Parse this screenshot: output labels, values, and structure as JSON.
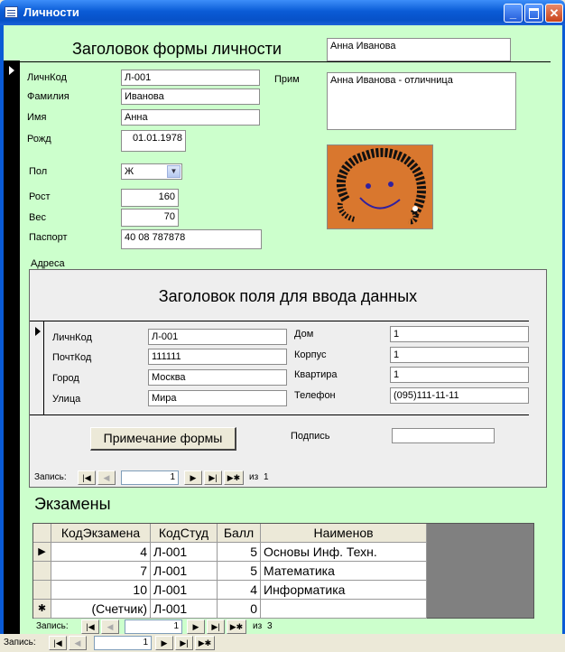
{
  "window": {
    "title": "Личности"
  },
  "form": {
    "header_title": "Заголовок формы личности",
    "header_name_value": "Анна Иванова",
    "fields": {
      "lichkod": {
        "label": "ЛичнКод",
        "value": "Л-001"
      },
      "familia": {
        "label": "Фамилия",
        "value": "Иванова"
      },
      "imya": {
        "label": "Имя",
        "value": "Анна"
      },
      "rozhd": {
        "label": "Рожд",
        "value": "01.01.1978"
      },
      "pol": {
        "label": "Пол",
        "value": "Ж"
      },
      "rost": {
        "label": "Рост",
        "value": "160"
      },
      "ves": {
        "label": "Вес",
        "value": "70"
      },
      "pasport": {
        "label": "Паспорт",
        "value": "40 08 787878"
      },
      "prim": {
        "label": "Прим",
        "value": "Анна Иванова - отличница"
      }
    },
    "photo_icon": "smiley-face-icon"
  },
  "address": {
    "section_label": "Адреса",
    "header_title": "Заголовок поля для ввода данных",
    "fields": {
      "lichkod": {
        "label": "ЛичнКод",
        "value": "Л-001"
      },
      "pochtkod": {
        "label": "ПочтКод",
        "value": "111111"
      },
      "gorod": {
        "label": "Город",
        "value": "Москва"
      },
      "ulica": {
        "label": "Улица",
        "value": "Мира"
      },
      "dom": {
        "label": "Дом",
        "value": "1"
      },
      "korpus": {
        "label": "Корпус",
        "value": "1"
      },
      "kvartira": {
        "label": "Квартира",
        "value": "1"
      },
      "telefon": {
        "label": "Телефон",
        "value": "(095)111-11-11"
      }
    },
    "note_button": "Примечание формы",
    "signature_label": "Подпись",
    "signature_value": "",
    "nav": {
      "label": "Запись:",
      "current": "1",
      "of_label": "из",
      "total": "1"
    }
  },
  "exams": {
    "title": "Экзамены",
    "columns": [
      "КодЭкзамена",
      "КодСтуд",
      "Балл",
      "Наименов"
    ],
    "rows": [
      {
        "marker": "▶",
        "cells": [
          "4",
          "Л-001",
          "5",
          "Основы Инф. Техн."
        ]
      },
      {
        "marker": "",
        "cells": [
          "7",
          "Л-001",
          "5",
          "Математика"
        ]
      },
      {
        "marker": "",
        "cells": [
          "10",
          "Л-001",
          "4",
          "Информатика"
        ]
      },
      {
        "marker": "✱",
        "cells": [
          "(Счетчик)",
          "Л-001",
          "0",
          ""
        ]
      }
    ],
    "nav": {
      "label": "Запись:",
      "current": "1",
      "of_label": "из",
      "total": "3"
    }
  },
  "main_nav": {
    "label": "Запись:",
    "current": "1"
  },
  "nav_glyphs": {
    "first": "|◀",
    "prev": "◀",
    "next": "▶",
    "last": "▶|",
    "new": "▶✱"
  },
  "colors": {
    "form_bg": "#ccffcc",
    "titlebar": "#0a5bd6",
    "grid_empty": "#808080"
  }
}
